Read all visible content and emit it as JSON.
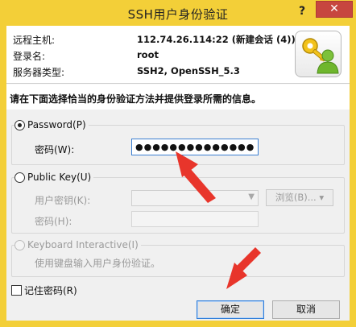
{
  "window": {
    "title": "SSH用户身份验证",
    "help_label": "?",
    "close_label": "✕"
  },
  "info": {
    "rows": [
      {
        "label": "远程主机:",
        "value": "112.74.26.114:22 (新建会话 (4))"
      },
      {
        "label": "登录名:",
        "value": "root"
      },
      {
        "label": "服务器类型:",
        "value": "SSH2, OpenSSH_5.3"
      }
    ],
    "avatar_icon": "user-key-icon"
  },
  "instruction": "请在下面选择恰当的身份验证方法并提供登录所需的信息。",
  "password_method": {
    "label": "Password(P)",
    "selected": true,
    "field_label": "密码(W):",
    "value": "●●●●●●●●●●●●●●"
  },
  "publickey_method": {
    "label": "Public Key(U)",
    "selected": false,
    "key_label": "用户密钥(K):",
    "key_value": "",
    "browse_label": "浏览(B)... ▾",
    "passphrase_label": "密码(H):"
  },
  "keyboard_method": {
    "label": "Keyboard Interactive(I)",
    "selected": false,
    "hint": "使用键盘输入用户身份验证。"
  },
  "remember": {
    "label": "记住密码(R)",
    "checked": false
  },
  "buttons": {
    "ok": "确定",
    "cancel": "取消"
  },
  "colors": {
    "title_bar": "#f3cf38",
    "close_button": "#c7463f",
    "annotation_arrow": "#e8352b",
    "focus_border": "#3b7fd1"
  }
}
